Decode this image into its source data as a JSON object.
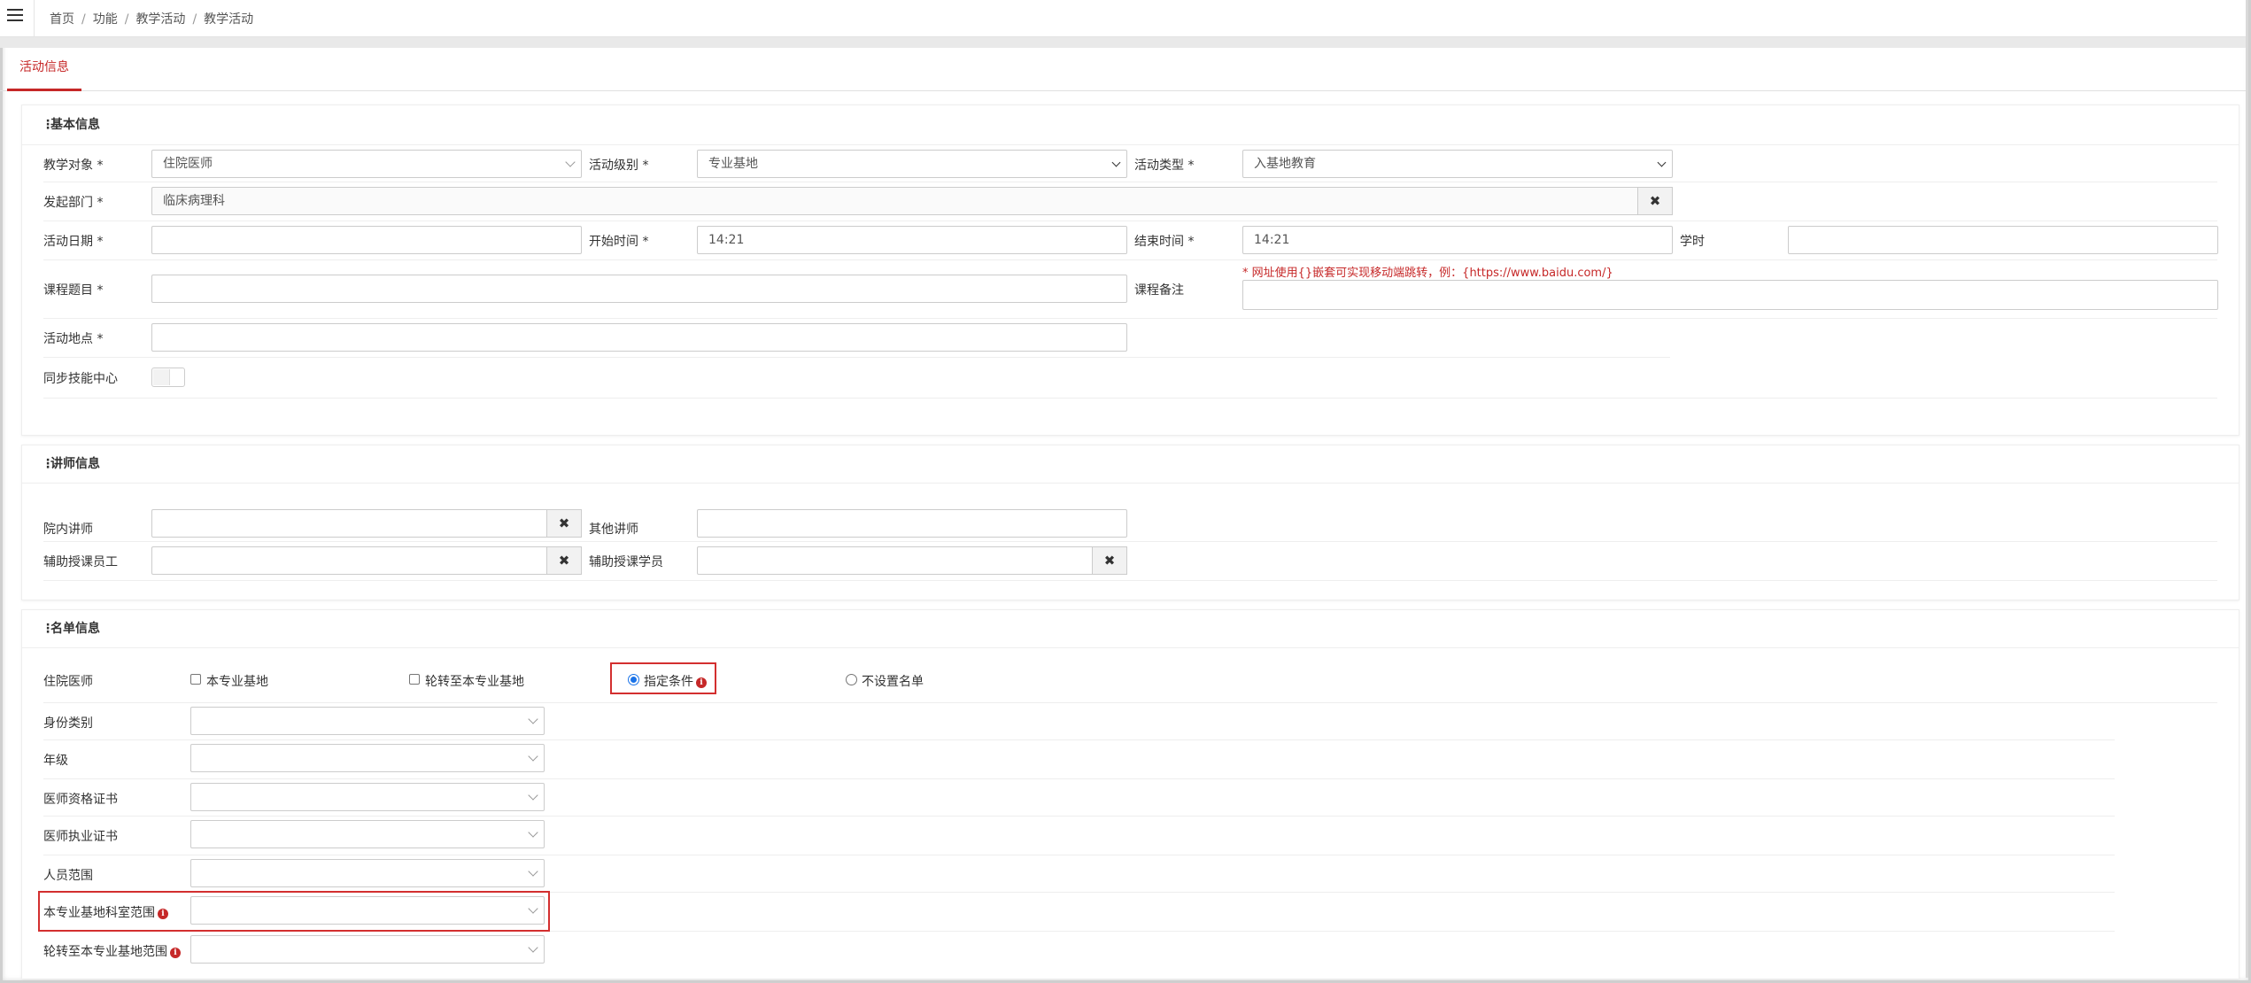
{
  "breadcrumb": {
    "home": "首页",
    "func": "功能",
    "section": "教学活动",
    "current": "教学活动",
    "sep": "/"
  },
  "tabs": {
    "active": "活动信息"
  },
  "basic": {
    "title": "基本信息",
    "target_label": "教学对象 *",
    "target_value": "住院医师",
    "level_label": "活动级别 *",
    "level_value": "专业基地",
    "type_label": "活动类型 *",
    "type_value": "入基地教育",
    "dept_label": "发起部门 *",
    "dept_value": "临床病理科",
    "date_label": "活动日期 *",
    "date_value": "",
    "start_label": "开始时间 *",
    "start_value": "14:21",
    "end_label": "结束时间 *",
    "end_value": "14:21",
    "hours_label": "学时",
    "hours_value": "",
    "course_label": "课程题目 *",
    "course_value": "",
    "remark_label": "课程备注",
    "remark_hint": "* 网址使用{}嵌套可实现移动端跳转，例：{https://www.baidu.com/}",
    "remark_value": "",
    "place_label": "活动地点 *",
    "place_value": "",
    "sync_label": "同步技能中心"
  },
  "lecturer": {
    "title": "讲师信息",
    "inner_label": "院内讲师",
    "inner_value": "",
    "other_label": "其他讲师",
    "other_value": "",
    "assist_staff_label": "辅助授课员工",
    "assist_staff_value": "",
    "assist_student_label": "辅助授课学员",
    "assist_student_value": "",
    "clear": "✖"
  },
  "roster": {
    "title": "名单信息",
    "resident_label": "住院医师",
    "options": [
      "本专业基地",
      "轮转至本专业基地",
      "指定条件",
      "不设置名单"
    ],
    "selected": "指定条件",
    "identity_label": "身份类别",
    "grade_label": "年级",
    "qualification_label": "医师资格证书",
    "practice_label": "医师执业证书",
    "scope_label": "人员范围",
    "dept_scope_label": "本专业基地科室范围",
    "rotate_scope_label": "轮转至本专业基地范围",
    "info": "i"
  }
}
